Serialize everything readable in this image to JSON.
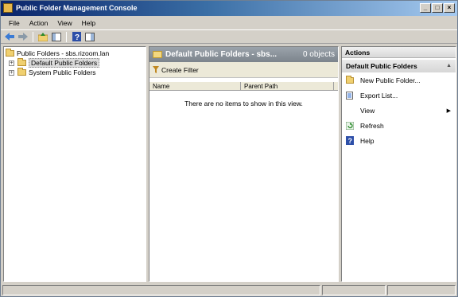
{
  "window": {
    "title": "Public Folder Management Console",
    "buttons": {
      "minimize": "_",
      "maximize": "□",
      "close": "×"
    }
  },
  "menu": [
    "File",
    "Action",
    "View",
    "Help"
  ],
  "toolbar": {
    "icons": [
      "back-arrow-icon",
      "forward-arrow-icon",
      "up-folder-icon",
      "show-hide-tree-icon",
      "help-icon",
      "action-pane-icon"
    ]
  },
  "tree": {
    "root": "Public Folders - sbs.rizoom.lan",
    "items": [
      {
        "label": "Default Public Folders",
        "selected": true
      },
      {
        "label": "System Public Folders",
        "selected": false
      }
    ],
    "expander": "+"
  },
  "center": {
    "title": "Default Public Folders - sbs...",
    "count": "0 objects",
    "filter_label": "Create Filter",
    "columns": [
      "Name",
      "Parent Path"
    ],
    "empty_message": "There are no items to show in this view."
  },
  "actions": {
    "header": "Actions",
    "section": "Default Public Folders",
    "collapse_glyph": "▲",
    "items": [
      {
        "label": "New Public Folder...",
        "icon": "new-folder-icon"
      },
      {
        "label": "Export List...",
        "icon": "export-list-icon"
      },
      {
        "label": "View",
        "icon": "none",
        "submenu": "▶"
      },
      {
        "label": "Refresh",
        "icon": "refresh-icon"
      },
      {
        "label": "Help",
        "icon": "help-icon"
      }
    ]
  },
  "colors": {
    "title_gradient_start": "#0a246a",
    "title_gradient_end": "#a6caf0",
    "chrome": "#d4d0c8",
    "center_header": "#8a9299",
    "folder_yellow": "#f0d070"
  }
}
